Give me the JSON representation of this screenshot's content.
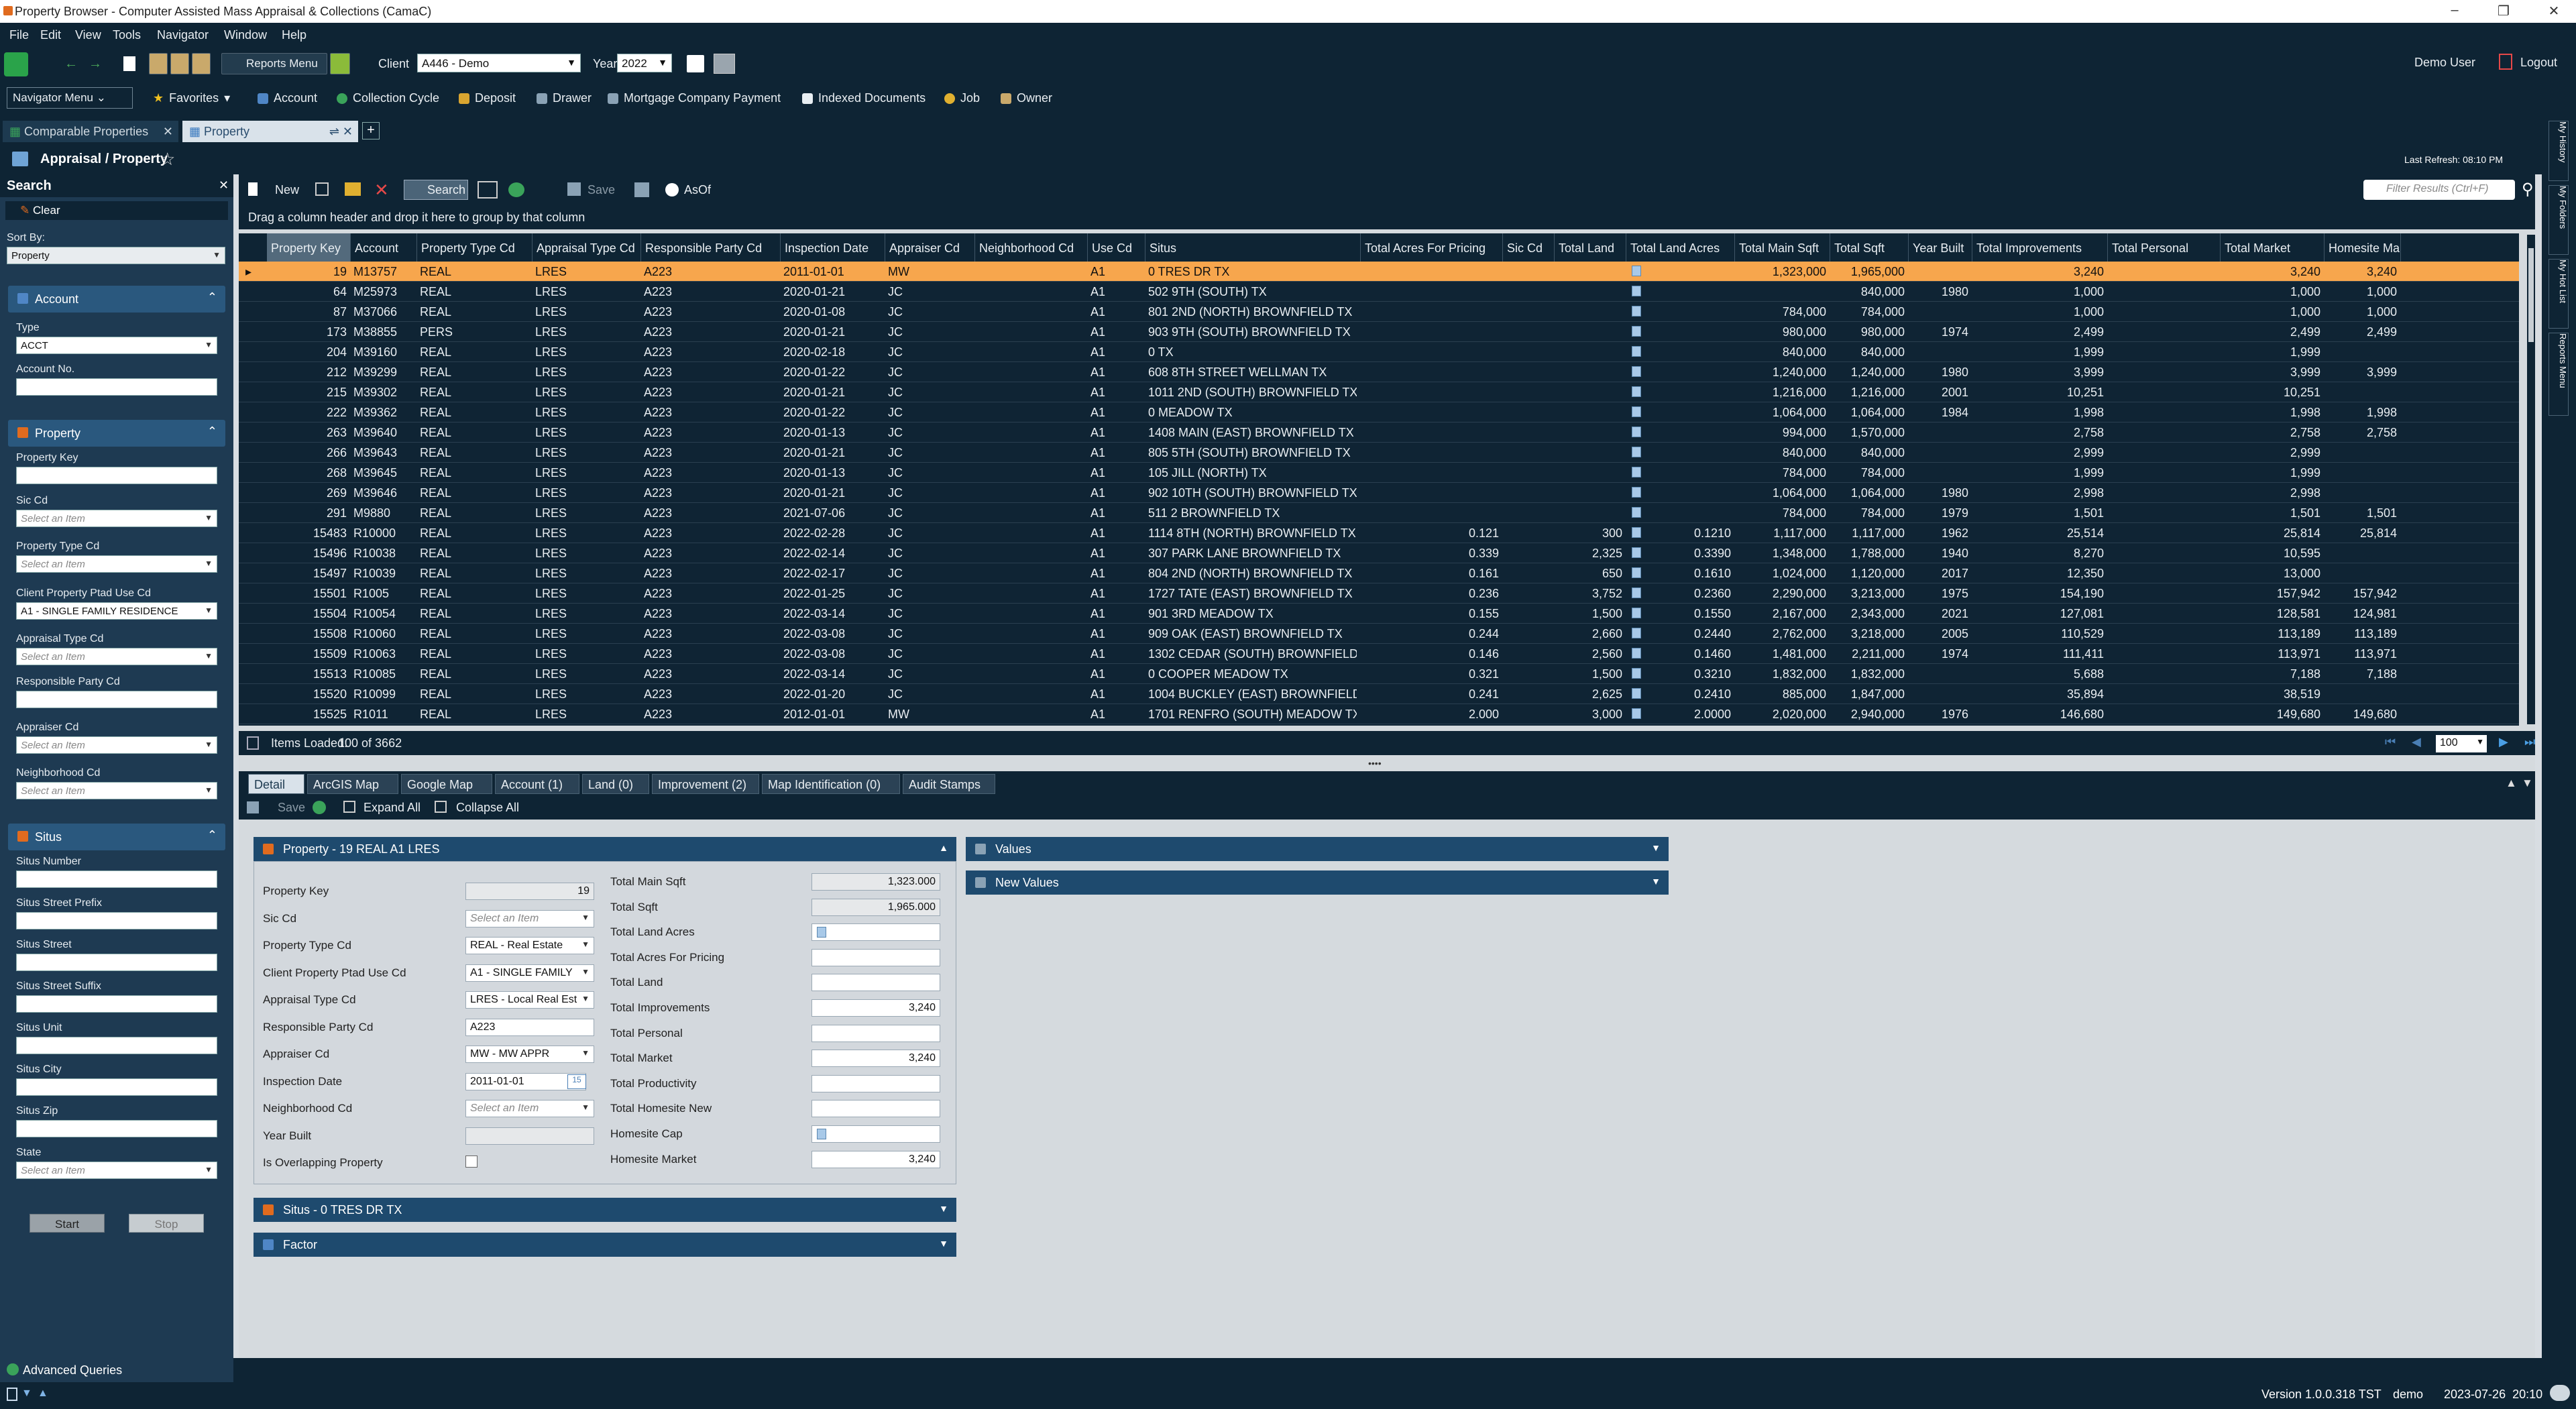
{
  "window": {
    "title": "Property Browser - Computer Assisted Mass Appraisal & Collections (CamaC)"
  },
  "menu": [
    "File",
    "Edit",
    "View",
    "Tools",
    "Navigator",
    "Window",
    "Help"
  ],
  "toolbar": {
    "reports_menu": "Reports Menu",
    "client_label": "Client",
    "client_value": "A446 - Demo",
    "year_label": "Year",
    "year_value": "2022",
    "user": "Demo User",
    "logout": "Logout"
  },
  "navbar": {
    "navigator_menu": "Navigator Menu",
    "favorites": "Favorites",
    "items": [
      "Account",
      "Collection Cycle",
      "Deposit",
      "Drawer",
      "Mortgage Company Payment",
      "Indexed Documents",
      "Job",
      "Owner"
    ]
  },
  "tabs": [
    {
      "label": "Comparable Properties"
    },
    {
      "label": "Property"
    }
  ],
  "breadcrumb": "Appraisal / Property",
  "last_refresh": "Last Refresh: 08:10 PM",
  "left": {
    "search_title": "Search",
    "clear": "Clear",
    "sort_by_label": "Sort By:",
    "sort_by_value": "Property",
    "account_section": "Account",
    "type_label": "Type",
    "type_value": "ACCT",
    "account_no_label": "Account No.",
    "property_section": "Property",
    "property_key_label": "Property Key",
    "sic_cd_label": "Sic Cd",
    "property_type_cd_label": "Property Type Cd",
    "client_ptad_label": "Client Property Ptad Use Cd",
    "client_ptad_value": "A1 - SINGLE FAMILY RESIDENCE",
    "appraisal_type_label": "Appraisal Type Cd",
    "responsible_party_label": "Responsible Party Cd",
    "appraiser_label": "Appraiser Cd",
    "neighborhood_label": "Neighborhood Cd",
    "situs_section": "Situs",
    "situs_number": "Situs Number",
    "situs_street_prefix": "Situs Street Prefix",
    "situs_street": "Situs Street",
    "situs_street_suffix": "Situs Street Suffix",
    "situs_unit": "Situs Unit",
    "situs_city": "Situs City",
    "situs_zip": "Situs Zip",
    "state_label": "State",
    "placeholder": "Select an Item",
    "start": "Start",
    "stop": "Stop"
  },
  "gridtoolbar": {
    "new": "New",
    "search": "Search",
    "save": "Save",
    "asof": "AsOf",
    "filter_placeholder": "Filter Results (Ctrl+F)"
  },
  "group_hint": "Drag a column header and drop it here to group by that column",
  "columns": [
    "Property Key",
    "Account",
    "Property Type Cd",
    "Appraisal Type Cd",
    "Responsible Party Cd",
    "Inspection Date",
    "Appraiser Cd",
    "Neighborhood Cd",
    "Use Cd",
    "Situs",
    "Total Acres For Pricing",
    "Sic Cd",
    "Total Land",
    "Total Land Acres",
    "Total Main Sqft",
    "Total Sqft",
    "Year Built",
    "Total Improvements",
    "Total Personal",
    "Total Market",
    "Homesite Market"
  ],
  "rows": [
    [
      "19",
      "M13757",
      "REAL",
      "LRES",
      "A223",
      "2011-01-01",
      "MW",
      "",
      "A1",
      "0 TRES DR TX",
      "",
      "",
      "",
      "",
      "1,323,000",
      "1,965,000",
      "",
      "3,240",
      "",
      "3,240",
      "3,240"
    ],
    [
      "64",
      "M25973",
      "REAL",
      "LRES",
      "A223",
      "2020-01-21",
      "JC",
      "",
      "A1",
      "502 9TH (SOUTH) TX",
      "",
      "",
      "",
      "",
      "",
      "840,000",
      "1980",
      "1,000",
      "",
      "1,000",
      "1,000"
    ],
    [
      "87",
      "M37066",
      "REAL",
      "LRES",
      "A223",
      "2020-01-08",
      "JC",
      "",
      "A1",
      "801 2ND (NORTH) BROWNFIELD TX",
      "",
      "",
      "",
      "",
      "784,000",
      "784,000",
      "",
      "1,000",
      "",
      "1,000",
      "1,000"
    ],
    [
      "173",
      "M38855",
      "PERS",
      "LRES",
      "A223",
      "2020-01-21",
      "JC",
      "",
      "A1",
      "903 9TH (SOUTH) BROWNFIELD TX",
      "",
      "",
      "",
      "",
      "980,000",
      "980,000",
      "1974",
      "2,499",
      "",
      "2,499",
      "2,499"
    ],
    [
      "204",
      "M39160",
      "REAL",
      "LRES",
      "A223",
      "2020-02-18",
      "JC",
      "",
      "A1",
      "0 TX",
      "",
      "",
      "",
      "",
      "840,000",
      "840,000",
      "",
      "1,999",
      "",
      "1,999",
      ""
    ],
    [
      "212",
      "M39299",
      "REAL",
      "LRES",
      "A223",
      "2020-01-22",
      "JC",
      "",
      "A1",
      "608 8TH STREET WELLMAN TX",
      "",
      "",
      "",
      "",
      "1,240,000",
      "1,240,000",
      "1980",
      "3,999",
      "",
      "3,999",
      "3,999"
    ],
    [
      "215",
      "M39302",
      "REAL",
      "LRES",
      "A223",
      "2020-01-21",
      "JC",
      "",
      "A1",
      "1011 2ND (SOUTH) BROWNFIELD TX",
      "",
      "",
      "",
      "",
      "1,216,000",
      "1,216,000",
      "2001",
      "10,251",
      "",
      "10,251",
      ""
    ],
    [
      "222",
      "M39362",
      "REAL",
      "LRES",
      "A223",
      "2020-01-22",
      "JC",
      "",
      "A1",
      "0 MEADOW TX",
      "",
      "",
      "",
      "",
      "1,064,000",
      "1,064,000",
      "1984",
      "1,998",
      "",
      "1,998",
      "1,998"
    ],
    [
      "263",
      "M39640",
      "REAL",
      "LRES",
      "A223",
      "2020-01-13",
      "JC",
      "",
      "A1",
      "1408 MAIN (EAST) BROWNFIELD TX",
      "",
      "",
      "",
      "",
      "994,000",
      "1,570,000",
      "",
      "2,758",
      "",
      "2,758",
      "2,758"
    ],
    [
      "266",
      "M39643",
      "REAL",
      "LRES",
      "A223",
      "2020-01-21",
      "JC",
      "",
      "A1",
      "805 5TH (SOUTH) BROWNFIELD TX",
      "",
      "",
      "",
      "",
      "840,000",
      "840,000",
      "",
      "2,999",
      "",
      "2,999",
      ""
    ],
    [
      "268",
      "M39645",
      "REAL",
      "LRES",
      "A223",
      "2020-01-13",
      "JC",
      "",
      "A1",
      "105 JILL (NORTH) TX",
      "",
      "",
      "",
      "",
      "784,000",
      "784,000",
      "",
      "1,999",
      "",
      "1,999",
      ""
    ],
    [
      "269",
      "M39646",
      "REAL",
      "LRES",
      "A223",
      "2020-01-21",
      "JC",
      "",
      "A1",
      "902 10TH (SOUTH) BROWNFIELD TX",
      "",
      "",
      "",
      "",
      "1,064,000",
      "1,064,000",
      "1980",
      "2,998",
      "",
      "2,998",
      ""
    ],
    [
      "291",
      "M9880",
      "REAL",
      "LRES",
      "A223",
      "2021-07-06",
      "JC",
      "",
      "A1",
      "511 2 BROWNFIELD TX",
      "",
      "",
      "",
      "",
      "784,000",
      "784,000",
      "1979",
      "1,501",
      "",
      "1,501",
      "1,501"
    ],
    [
      "15483",
      "R10000",
      "REAL",
      "LRES",
      "A223",
      "2022-02-28",
      "JC",
      "",
      "A1",
      "1114 8TH (NORTH) BROWNFIELD TX",
      "0.121",
      "",
      "300",
      "0.1210",
      "1,117,000",
      "1,117,000",
      "1962",
      "25,514",
      "",
      "25,814",
      "25,814"
    ],
    [
      "15496",
      "R10038",
      "REAL",
      "LRES",
      "A223",
      "2022-02-14",
      "JC",
      "",
      "A1",
      "307 PARK LANE BROWNFIELD TX",
      "0.339",
      "",
      "2,325",
      "0.3390",
      "1,348,000",
      "1,788,000",
      "1940",
      "8,270",
      "",
      "10,595",
      ""
    ],
    [
      "15497",
      "R10039",
      "REAL",
      "LRES",
      "A223",
      "2022-02-17",
      "JC",
      "",
      "A1",
      "804 2ND (NORTH) BROWNFIELD TX",
      "0.161",
      "",
      "650",
      "0.1610",
      "1,024,000",
      "1,120,000",
      "2017",
      "12,350",
      "",
      "13,000",
      ""
    ],
    [
      "15501",
      "R1005",
      "REAL",
      "LRES",
      "A223",
      "2022-01-25",
      "JC",
      "",
      "A1",
      "1727 TATE (EAST) BROWNFIELD TX",
      "0.236",
      "",
      "3,752",
      "0.2360",
      "2,290,000",
      "3,213,000",
      "1975",
      "154,190",
      "",
      "157,942",
      "157,942"
    ],
    [
      "15504",
      "R10054",
      "REAL",
      "LRES",
      "A223",
      "2022-03-14",
      "JC",
      "",
      "A1",
      "901 3RD MEADOW TX",
      "0.155",
      "",
      "1,500",
      "0.1550",
      "2,167,000",
      "2,343,000",
      "2021",
      "127,081",
      "",
      "128,581",
      "124,981"
    ],
    [
      "15508",
      "R10060",
      "REAL",
      "LRES",
      "A223",
      "2022-03-08",
      "JC",
      "",
      "A1",
      "909 OAK (EAST) BROWNFIELD TX",
      "0.244",
      "",
      "2,660",
      "0.2440",
      "2,762,000",
      "3,218,000",
      "2005",
      "110,529",
      "",
      "113,189",
      "113,189"
    ],
    [
      "15509",
      "R10063",
      "REAL",
      "LRES",
      "A223",
      "2022-03-08",
      "JC",
      "",
      "A1",
      "1302 CEDAR (SOUTH) BROWNFIELD TX",
      "0.146",
      "",
      "2,560",
      "0.1460",
      "1,481,000",
      "2,211,000",
      "1974",
      "111,411",
      "",
      "113,971",
      "113,971"
    ],
    [
      "15513",
      "R10085",
      "REAL",
      "LRES",
      "A223",
      "2022-03-14",
      "JC",
      "",
      "A1",
      "0 COOPER MEADOW TX",
      "0.321",
      "",
      "1,500",
      "0.3210",
      "1,832,000",
      "1,832,000",
      "",
      "5,688",
      "",
      "7,188",
      "7,188"
    ],
    [
      "15520",
      "R10099",
      "REAL",
      "LRES",
      "A223",
      "2022-01-20",
      "JC",
      "",
      "A1",
      "1004 BUCKLEY (EAST) BROWNFIELD TX",
      "0.241",
      "",
      "2,625",
      "0.2410",
      "885,000",
      "1,847,000",
      "",
      "35,894",
      "",
      "38,519",
      ""
    ],
    [
      "15525",
      "R1011",
      "REAL",
      "LRES",
      "A223",
      "2012-01-01",
      "MW",
      "",
      "A1",
      "1701 RENFRO (SOUTH) MEADOW TX",
      "2.000",
      "",
      "3,000",
      "2.0000",
      "2,020,000",
      "2,940,000",
      "1976",
      "146,680",
      "",
      "149,680",
      "149,680"
    ]
  ],
  "footer": {
    "items_loaded_label": "Items Loaded:",
    "items_loaded_value": "100 of 3662",
    "page_size": "100"
  },
  "detail_tabs": [
    "Detail",
    "ArcGIS Map",
    "Google Map",
    "Account (1)",
    "Land (0)",
    "Improvement (2)",
    "Map Identification (0)",
    "Audit Stamps"
  ],
  "detail_toolbar": {
    "save": "Save",
    "expand_all": "Expand All",
    "collapse_all": "Collapse All"
  },
  "property_panel": {
    "title": "Property - 19 REAL A1 LRES",
    "left_fields": [
      {
        "label": "Property Key",
        "value": "19"
      },
      {
        "label": "Sic Cd",
        "value": "Select an Item"
      },
      {
        "label": "Property Type Cd",
        "value": "REAL - Real Estate"
      },
      {
        "label": "Client Property Ptad Use Cd",
        "value": "A1 - SINGLE FAMILY"
      },
      {
        "label": "Appraisal Type Cd",
        "value": "LRES - Local Real Est"
      },
      {
        "label": "Responsible Party Cd",
        "value": "A223"
      },
      {
        "label": "Appraiser Cd",
        "value": "MW - MW APPR"
      },
      {
        "label": "Inspection Date",
        "value": "2011-01-01"
      },
      {
        "label": "Neighborhood Cd",
        "value": "Select an Item"
      },
      {
        "label": "Year Built",
        "value": ""
      },
      {
        "label": "Is Overlapping Property",
        "value": ""
      }
    ],
    "right_fields": [
      {
        "label": "Total Main Sqft",
        "value": "1,323.000"
      },
      {
        "label": "Total Sqft",
        "value": "1,965.000"
      },
      {
        "label": "Total Land Acres",
        "value": ""
      },
      {
        "label": "Total Acres For Pricing",
        "value": ""
      },
      {
        "label": "Total Land",
        "value": ""
      },
      {
        "label": "Total Improvements",
        "value": "3,240"
      },
      {
        "label": "Total Personal",
        "value": ""
      },
      {
        "label": "Total Market",
        "value": "3,240"
      },
      {
        "label": "Total Productivity",
        "value": ""
      },
      {
        "label": "Total Homesite New",
        "value": ""
      },
      {
        "label": "Homesite Cap",
        "value": ""
      },
      {
        "label": "Homesite Market",
        "value": "3,240"
      }
    ]
  },
  "situs_panel": "Situs - 0 TRES DR TX",
  "factor_panel": "Factor",
  "values_panel": "Values",
  "new_values_panel": "New Values",
  "right_strip": [
    "My History",
    "My Folders",
    "My Hot List",
    "Reports Menu"
  ],
  "status": {
    "advanced_queries": "Advanced Queries",
    "version": "Version 1.0.0.318 TST",
    "user": "demo",
    "datetime": "2023-07-26  20:10"
  }
}
